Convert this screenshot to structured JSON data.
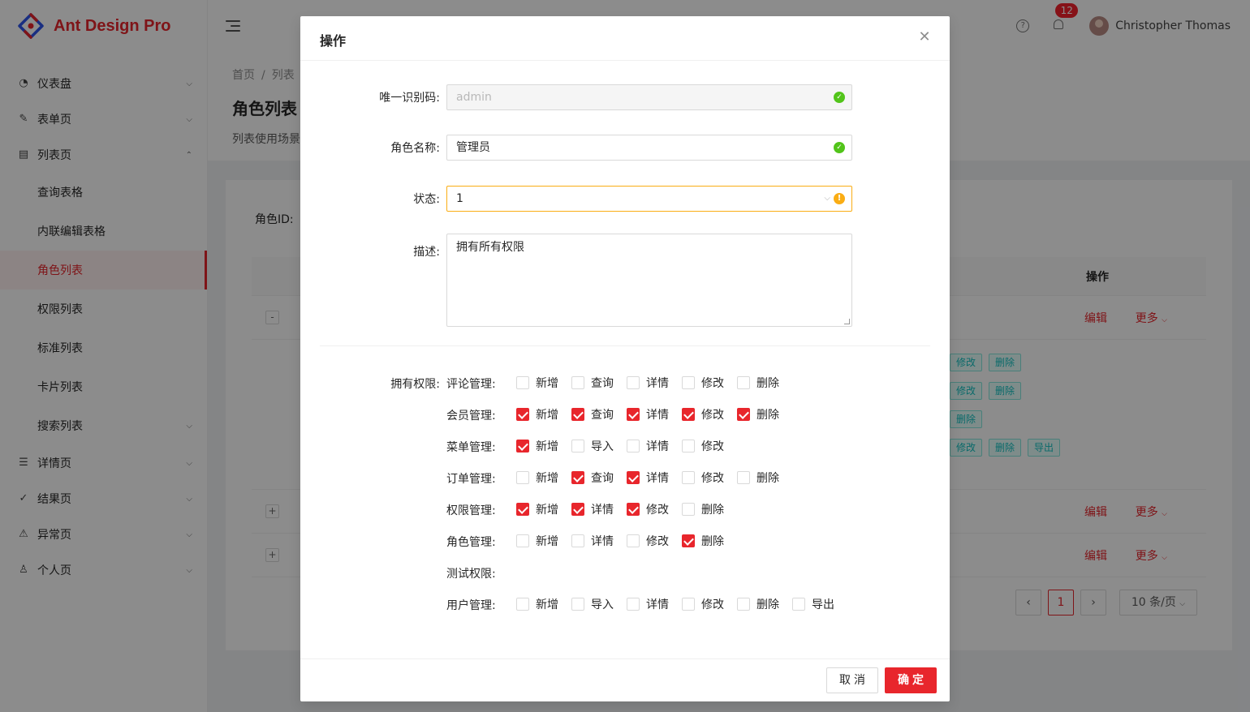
{
  "brand": {
    "title": "Ant Design Pro",
    "accent": "#e8262c"
  },
  "sidebar": {
    "items": [
      {
        "label": "仪表盘",
        "icon": "dashboard-icon",
        "expanded": false
      },
      {
        "label": "表单页",
        "icon": "form-icon",
        "expanded": false
      },
      {
        "label": "列表页",
        "icon": "table-icon",
        "expanded": true
      },
      {
        "label": "详情页",
        "icon": "profile-icon",
        "expanded": false
      },
      {
        "label": "结果页",
        "icon": "check-circle-icon",
        "expanded": false
      },
      {
        "label": "异常页",
        "icon": "warning-icon",
        "expanded": false
      },
      {
        "label": "个人页",
        "icon": "user-icon",
        "expanded": false
      }
    ],
    "list_sub_items": [
      "查询表格",
      "内联编辑表格",
      "角色列表",
      "权限列表",
      "标准列表",
      "卡片列表",
      "搜索列表"
    ],
    "active_sub_item": "角色列表"
  },
  "header": {
    "notification_count": "12",
    "user_name": "Christopher Thomas"
  },
  "page": {
    "breadcrumb": [
      "首页",
      "列表"
    ],
    "title": "角色列表",
    "description": "列表使用场景",
    "filter_label": "角色ID:",
    "table_action_header": "操作",
    "row_edit": "编辑",
    "row_more": "更多",
    "tags": [
      "修改",
      "删除",
      "修改",
      "删除",
      "删除",
      "修改",
      "删除",
      "导出"
    ],
    "pagination": {
      "current": "1",
      "page_size": "10 条/页"
    }
  },
  "modal": {
    "title": "操作",
    "fields": {
      "code_label": "唯一识别码:",
      "code_value": "admin",
      "name_label": "角色名称:",
      "name_value": "管理员",
      "status_label": "状态:",
      "status_value": "1",
      "desc_label": "描述:",
      "desc_value": "拥有所有权限"
    },
    "permissions_label": "拥有权限:",
    "permissions": [
      {
        "name": "评论管理:",
        "options": [
          {
            "label": "新增",
            "checked": false
          },
          {
            "label": "查询",
            "checked": false
          },
          {
            "label": "详情",
            "checked": false
          },
          {
            "label": "修改",
            "checked": false
          },
          {
            "label": "删除",
            "checked": false
          }
        ]
      },
      {
        "name": "会员管理:",
        "options": [
          {
            "label": "新增",
            "checked": true
          },
          {
            "label": "查询",
            "checked": true
          },
          {
            "label": "详情",
            "checked": true
          },
          {
            "label": "修改",
            "checked": true
          },
          {
            "label": "删除",
            "checked": true
          }
        ]
      },
      {
        "name": "菜单管理:",
        "options": [
          {
            "label": "新增",
            "checked": true
          },
          {
            "label": "导入",
            "checked": false
          },
          {
            "label": "详情",
            "checked": false
          },
          {
            "label": "修改",
            "checked": false
          }
        ]
      },
      {
        "name": "订单管理:",
        "options": [
          {
            "label": "新增",
            "checked": false
          },
          {
            "label": "查询",
            "checked": true
          },
          {
            "label": "详情",
            "checked": true
          },
          {
            "label": "修改",
            "checked": false
          },
          {
            "label": "删除",
            "checked": false
          }
        ]
      },
      {
        "name": "权限管理:",
        "options": [
          {
            "label": "新增",
            "checked": true
          },
          {
            "label": "详情",
            "checked": true
          },
          {
            "label": "修改",
            "checked": true
          },
          {
            "label": "删除",
            "checked": false
          }
        ]
      },
      {
        "name": "角色管理:",
        "options": [
          {
            "label": "新增",
            "checked": false
          },
          {
            "label": "详情",
            "checked": false
          },
          {
            "label": "修改",
            "checked": false
          },
          {
            "label": "删除",
            "checked": true
          }
        ]
      },
      {
        "name": "测试权限:",
        "options": []
      },
      {
        "name": "用户管理:",
        "options": [
          {
            "label": "新增",
            "checked": false
          },
          {
            "label": "导入",
            "checked": false
          },
          {
            "label": "详情",
            "checked": false
          },
          {
            "label": "修改",
            "checked": false
          },
          {
            "label": "删除",
            "checked": false
          },
          {
            "label": "导出",
            "checked": false
          }
        ]
      }
    ],
    "cancel_label": "取消",
    "ok_label": "确定"
  }
}
